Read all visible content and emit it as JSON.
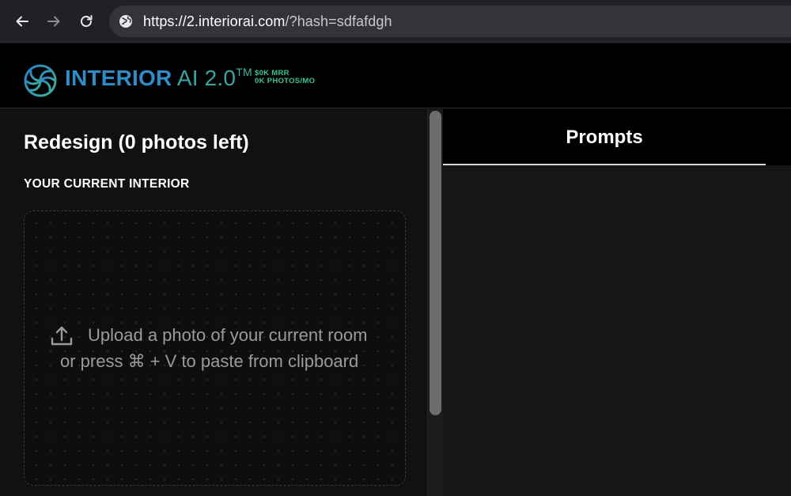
{
  "browser": {
    "url_host": "https://2.interiorai.com",
    "url_path": "/?hash=sdfafdgh",
    "icons": [
      "back-arrow-icon",
      "forward-arrow-icon",
      "reload-icon",
      "site-info-icon"
    ]
  },
  "header": {
    "brand_bold": "INTERIOR",
    "brand_light": " AI 2.0",
    "brand_tm": "TM",
    "stat_mrr": "$0K MRR",
    "stat_photos": "0K PHOTOS/MO",
    "colors": {
      "brand_blue": "#2e8cc9",
      "brand_teal": "#38a6a0",
      "stats_green": "#35c39a"
    }
  },
  "left": {
    "title": "Redesign (0 photos left)",
    "section_label": "YOUR CURRENT INTERIOR",
    "upload_line1": "Upload a photo of your current room",
    "upload_line2": "or press ⌘ + V to paste from clipboard"
  },
  "right": {
    "tab_label": "Prompts"
  }
}
